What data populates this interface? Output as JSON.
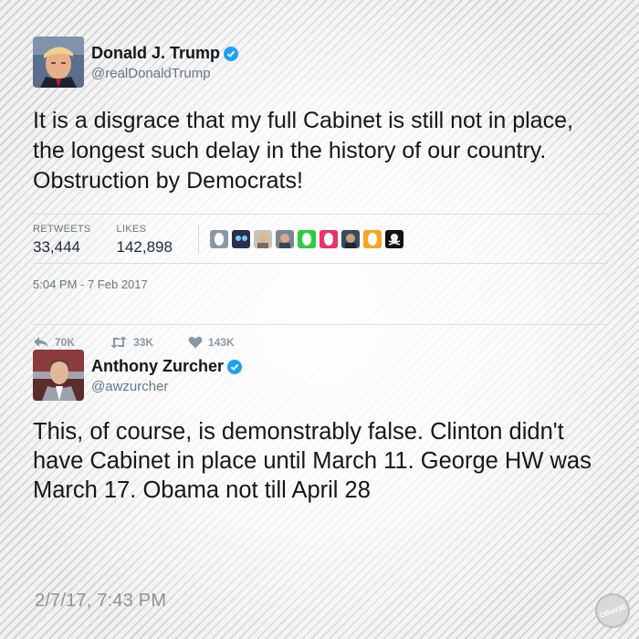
{
  "tweet1": {
    "name": "Donald J. Trump",
    "handle": "@realDonaldTrump",
    "text": "It is a disgrace that my full Cabinet is still not in place, the longest such delay in the history of our country. Obstruction by Democrats!",
    "retweets_label": "RETWEETS",
    "retweets_value": "33,444",
    "likes_label": "LIKES",
    "likes_value": "142,898",
    "timestamp": "5:04 PM - 7 Feb 2017",
    "actions": {
      "reply": "70K",
      "retweet": "33K",
      "like": "143K"
    }
  },
  "tweet2": {
    "name": "Anthony Zurcher",
    "handle": "@awzurcher",
    "text": "This, of course, is demonstrably false. Clinton didn't have Cabinet in place until March 11. George HW was March 17. Obama not till April 28"
  },
  "footer": {
    "timestamp": "2/7/17, 7:43 PM",
    "watermark": "Other98"
  },
  "colors": {
    "verified": "#1da1f2",
    "muted": "#657786",
    "action_icon": "#8899a6",
    "egg_green": "#2ecc40",
    "egg_pink": "#e8336d",
    "egg_orange": "#f5a623"
  }
}
